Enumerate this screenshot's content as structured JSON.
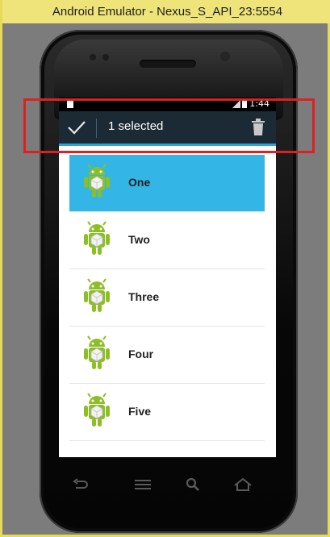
{
  "window": {
    "title": "Android Emulator - Nexus_S_API_23:5554"
  },
  "statusbar": {
    "time": "1:44"
  },
  "action_mode": {
    "title": "1 selected",
    "done_icon": "checkmark-icon",
    "delete_icon": "trash-icon"
  },
  "list": {
    "items": [
      {
        "label": "One",
        "selected": true
      },
      {
        "label": "Two",
        "selected": false
      },
      {
        "label": "Three",
        "selected": false
      },
      {
        "label": "Four",
        "selected": false
      },
      {
        "label": "Five",
        "selected": false
      }
    ],
    "item_icon": "android-robot-icon"
  },
  "colors": {
    "selection": "#33b5e5",
    "action_bar": "#1b2a34",
    "action_bar_accent": "#2ea3d8",
    "annotation": "#e02020",
    "emulator_frame": "#efe47a",
    "android_green": "#8cbf26"
  },
  "navbar": {
    "back_icon": "back-icon",
    "menu_icon": "menu-icon",
    "search_icon": "search-icon",
    "home_icon": "home-icon"
  }
}
